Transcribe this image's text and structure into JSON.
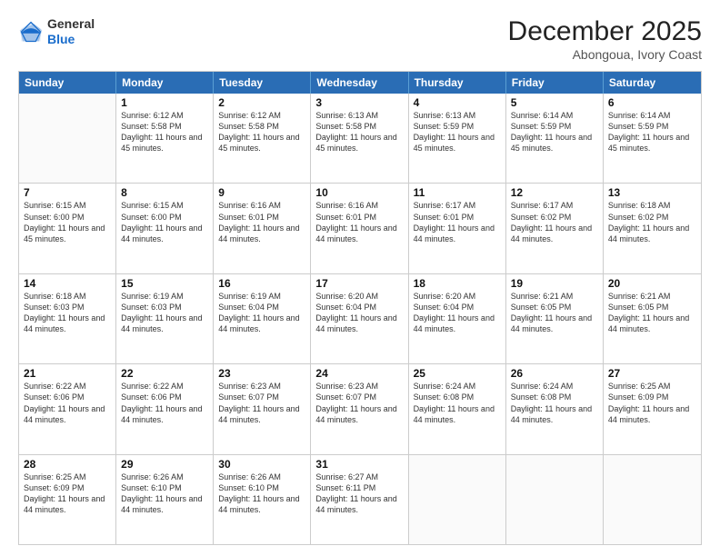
{
  "logo": {
    "general": "General",
    "blue": "Blue"
  },
  "header": {
    "month": "December 2025",
    "location": "Abongoua, Ivory Coast"
  },
  "days": [
    "Sunday",
    "Monday",
    "Tuesday",
    "Wednesday",
    "Thursday",
    "Friday",
    "Saturday"
  ],
  "weeks": [
    [
      {
        "day": "",
        "sunrise": "",
        "sunset": "",
        "daylight": ""
      },
      {
        "day": "1",
        "sunrise": "Sunrise: 6:12 AM",
        "sunset": "Sunset: 5:58 PM",
        "daylight": "Daylight: 11 hours and 45 minutes."
      },
      {
        "day": "2",
        "sunrise": "Sunrise: 6:12 AM",
        "sunset": "Sunset: 5:58 PM",
        "daylight": "Daylight: 11 hours and 45 minutes."
      },
      {
        "day": "3",
        "sunrise": "Sunrise: 6:13 AM",
        "sunset": "Sunset: 5:58 PM",
        "daylight": "Daylight: 11 hours and 45 minutes."
      },
      {
        "day": "4",
        "sunrise": "Sunrise: 6:13 AM",
        "sunset": "Sunset: 5:59 PM",
        "daylight": "Daylight: 11 hours and 45 minutes."
      },
      {
        "day": "5",
        "sunrise": "Sunrise: 6:14 AM",
        "sunset": "Sunset: 5:59 PM",
        "daylight": "Daylight: 11 hours and 45 minutes."
      },
      {
        "day": "6",
        "sunrise": "Sunrise: 6:14 AM",
        "sunset": "Sunset: 5:59 PM",
        "daylight": "Daylight: 11 hours and 45 minutes."
      }
    ],
    [
      {
        "day": "7",
        "sunrise": "Sunrise: 6:15 AM",
        "sunset": "Sunset: 6:00 PM",
        "daylight": "Daylight: 11 hours and 45 minutes."
      },
      {
        "day": "8",
        "sunrise": "Sunrise: 6:15 AM",
        "sunset": "Sunset: 6:00 PM",
        "daylight": "Daylight: 11 hours and 44 minutes."
      },
      {
        "day": "9",
        "sunrise": "Sunrise: 6:16 AM",
        "sunset": "Sunset: 6:01 PM",
        "daylight": "Daylight: 11 hours and 44 minutes."
      },
      {
        "day": "10",
        "sunrise": "Sunrise: 6:16 AM",
        "sunset": "Sunset: 6:01 PM",
        "daylight": "Daylight: 11 hours and 44 minutes."
      },
      {
        "day": "11",
        "sunrise": "Sunrise: 6:17 AM",
        "sunset": "Sunset: 6:01 PM",
        "daylight": "Daylight: 11 hours and 44 minutes."
      },
      {
        "day": "12",
        "sunrise": "Sunrise: 6:17 AM",
        "sunset": "Sunset: 6:02 PM",
        "daylight": "Daylight: 11 hours and 44 minutes."
      },
      {
        "day": "13",
        "sunrise": "Sunrise: 6:18 AM",
        "sunset": "Sunset: 6:02 PM",
        "daylight": "Daylight: 11 hours and 44 minutes."
      }
    ],
    [
      {
        "day": "14",
        "sunrise": "Sunrise: 6:18 AM",
        "sunset": "Sunset: 6:03 PM",
        "daylight": "Daylight: 11 hours and 44 minutes."
      },
      {
        "day": "15",
        "sunrise": "Sunrise: 6:19 AM",
        "sunset": "Sunset: 6:03 PM",
        "daylight": "Daylight: 11 hours and 44 minutes."
      },
      {
        "day": "16",
        "sunrise": "Sunrise: 6:19 AM",
        "sunset": "Sunset: 6:04 PM",
        "daylight": "Daylight: 11 hours and 44 minutes."
      },
      {
        "day": "17",
        "sunrise": "Sunrise: 6:20 AM",
        "sunset": "Sunset: 6:04 PM",
        "daylight": "Daylight: 11 hours and 44 minutes."
      },
      {
        "day": "18",
        "sunrise": "Sunrise: 6:20 AM",
        "sunset": "Sunset: 6:04 PM",
        "daylight": "Daylight: 11 hours and 44 minutes."
      },
      {
        "day": "19",
        "sunrise": "Sunrise: 6:21 AM",
        "sunset": "Sunset: 6:05 PM",
        "daylight": "Daylight: 11 hours and 44 minutes."
      },
      {
        "day": "20",
        "sunrise": "Sunrise: 6:21 AM",
        "sunset": "Sunset: 6:05 PM",
        "daylight": "Daylight: 11 hours and 44 minutes."
      }
    ],
    [
      {
        "day": "21",
        "sunrise": "Sunrise: 6:22 AM",
        "sunset": "Sunset: 6:06 PM",
        "daylight": "Daylight: 11 hours and 44 minutes."
      },
      {
        "day": "22",
        "sunrise": "Sunrise: 6:22 AM",
        "sunset": "Sunset: 6:06 PM",
        "daylight": "Daylight: 11 hours and 44 minutes."
      },
      {
        "day": "23",
        "sunrise": "Sunrise: 6:23 AM",
        "sunset": "Sunset: 6:07 PM",
        "daylight": "Daylight: 11 hours and 44 minutes."
      },
      {
        "day": "24",
        "sunrise": "Sunrise: 6:23 AM",
        "sunset": "Sunset: 6:07 PM",
        "daylight": "Daylight: 11 hours and 44 minutes."
      },
      {
        "day": "25",
        "sunrise": "Sunrise: 6:24 AM",
        "sunset": "Sunset: 6:08 PM",
        "daylight": "Daylight: 11 hours and 44 minutes."
      },
      {
        "day": "26",
        "sunrise": "Sunrise: 6:24 AM",
        "sunset": "Sunset: 6:08 PM",
        "daylight": "Daylight: 11 hours and 44 minutes."
      },
      {
        "day": "27",
        "sunrise": "Sunrise: 6:25 AM",
        "sunset": "Sunset: 6:09 PM",
        "daylight": "Daylight: 11 hours and 44 minutes."
      }
    ],
    [
      {
        "day": "28",
        "sunrise": "Sunrise: 6:25 AM",
        "sunset": "Sunset: 6:09 PM",
        "daylight": "Daylight: 11 hours and 44 minutes."
      },
      {
        "day": "29",
        "sunrise": "Sunrise: 6:26 AM",
        "sunset": "Sunset: 6:10 PM",
        "daylight": "Daylight: 11 hours and 44 minutes."
      },
      {
        "day": "30",
        "sunrise": "Sunrise: 6:26 AM",
        "sunset": "Sunset: 6:10 PM",
        "daylight": "Daylight: 11 hours and 44 minutes."
      },
      {
        "day": "31",
        "sunrise": "Sunrise: 6:27 AM",
        "sunset": "Sunset: 6:11 PM",
        "daylight": "Daylight: 11 hours and 44 minutes."
      },
      {
        "day": "",
        "sunrise": "",
        "sunset": "",
        "daylight": ""
      },
      {
        "day": "",
        "sunrise": "",
        "sunset": "",
        "daylight": ""
      },
      {
        "day": "",
        "sunrise": "",
        "sunset": "",
        "daylight": ""
      }
    ]
  ]
}
